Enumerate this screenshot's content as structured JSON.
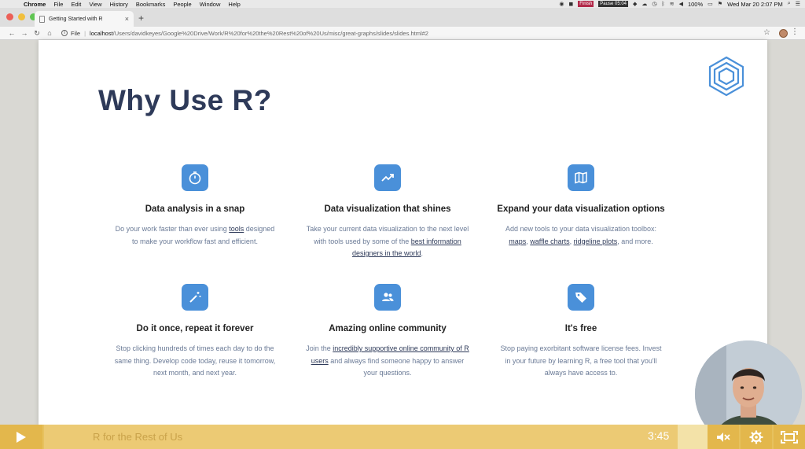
{
  "menubar": {
    "app": "Chrome",
    "items": [
      "File",
      "Edit",
      "View",
      "History",
      "Bookmarks",
      "People",
      "Window",
      "Help"
    ],
    "finish_badge": "Finish",
    "pause_badge": "Pause 05:04",
    "battery": "100%",
    "datetime": "Wed Mar 20  2:07 PM"
  },
  "browser": {
    "tab_title": "Getting Started with R",
    "url_scheme": "File",
    "url_host": "localhost",
    "url_path": "/Users/davidkeyes/Google%20Drive/Work/R%20for%20the%20Rest%20of%20Us/misc/great-graphs/slides/slides.html#2"
  },
  "slide": {
    "title": "Why Use R?",
    "features": [
      {
        "heading": "Data analysis in a snap",
        "text_a": "Do your work faster than ever using ",
        "link": "tools",
        "text_b": " designed to make your workflow fast and efficient."
      },
      {
        "heading": "Data visualization that shines",
        "text_a": "Take your current data visualization to the next level with tools used by some of the ",
        "link": "best information designers in the world",
        "text_b": "."
      },
      {
        "heading": "Expand your data visualization options",
        "text_a": "Add new tools to your data visualization toolbox: ",
        "links": [
          "maps",
          "waffle charts",
          "ridgeline plots"
        ],
        "text_b": ", and more."
      },
      {
        "heading": "Do it once, repeat it forever",
        "text": "Stop clicking hundreds of times each day to do the same thing. Develop code today, reuse it tomorrow, next month, and next year."
      },
      {
        "heading": "Amazing online community",
        "text_a": "Join the ",
        "link": "incredibly supportive online community of R users",
        "text_b": " and always find someone happy to answer your questions."
      },
      {
        "heading": "It's free",
        "text": "Stop paying exorbitant software license fees. Invest in your future by learning R, a free tool that you'll always have access to."
      }
    ]
  },
  "video": {
    "title": "R for the Rest of Us",
    "time": "3:45"
  },
  "colors": {
    "accent": "#4a90d9",
    "title": "#2e3a59",
    "video_bar": "#e7c15e"
  },
  "icons": [
    "stopwatch-icon",
    "trending-up-icon",
    "map-icon",
    "magic-wand-icon",
    "users-icon",
    "tag-icon",
    "hexagon-logo"
  ]
}
